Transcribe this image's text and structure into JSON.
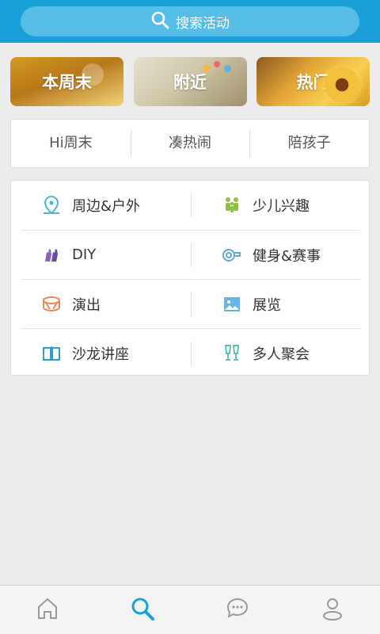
{
  "search": {
    "placeholder": "搜索活动",
    "icon": "search-icon"
  },
  "banners": [
    {
      "label": "本周末",
      "image": "wheat-field-image"
    },
    {
      "label": "附近",
      "image": "milk-bottles-image"
    },
    {
      "label": "热门",
      "image": "sunflower-image"
    }
  ],
  "tabs": [
    "Hi周末",
    "凑热闹",
    "陪孩子"
  ],
  "categories": [
    {
      "left": {
        "label": "周边&户外",
        "icon": "location-pin-icon"
      },
      "right": {
        "label": "少儿兴趣",
        "icon": "children-icon"
      }
    },
    {
      "left": {
        "label": "DIY",
        "icon": "gloves-icon"
      },
      "right": {
        "label": "健身&赛事",
        "icon": "whistle-icon"
      }
    },
    {
      "left": {
        "label": "演出",
        "icon": "drum-icon"
      },
      "right": {
        "label": "展览",
        "icon": "picture-icon"
      }
    },
    {
      "left": {
        "label": "沙龙讲座",
        "icon": "book-icon"
      },
      "right": {
        "label": "多人聚会",
        "icon": "toast-glasses-icon"
      }
    }
  ],
  "bottom_nav": [
    {
      "name": "home",
      "icon": "home-icon",
      "active": false
    },
    {
      "name": "search",
      "icon": "search-icon",
      "active": true
    },
    {
      "name": "messages",
      "icon": "chat-icon",
      "active": false
    },
    {
      "name": "profile",
      "icon": "user-icon",
      "active": false
    }
  ],
  "colors": {
    "brand": "#1aa0d8",
    "search_bg": "#55bde6",
    "active_nav": "#1aa0d8",
    "inactive_nav": "#9a9a9a"
  }
}
